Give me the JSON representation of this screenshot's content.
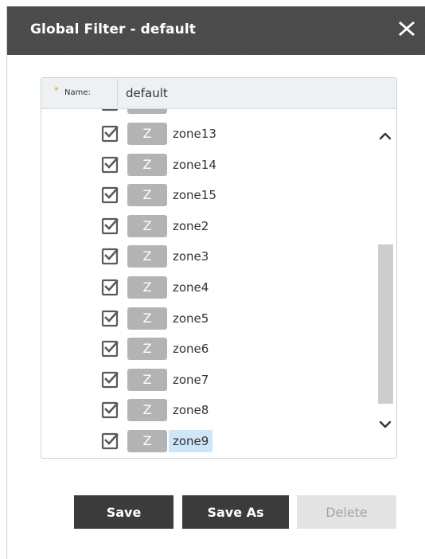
{
  "dialog": {
    "title": "Global Filter - default",
    "close_icon": "close-icon"
  },
  "form": {
    "required_marker": "*",
    "name_label": "Name:",
    "name_value": "default"
  },
  "zones": [
    {
      "badge": "Z",
      "name": "zone13",
      "checked": true,
      "selected": false
    },
    {
      "badge": "Z",
      "name": "zone14",
      "checked": true,
      "selected": false
    },
    {
      "badge": "Z",
      "name": "zone15",
      "checked": true,
      "selected": false
    },
    {
      "badge": "Z",
      "name": "zone2",
      "checked": true,
      "selected": false
    },
    {
      "badge": "Z",
      "name": "zone3",
      "checked": true,
      "selected": false
    },
    {
      "badge": "Z",
      "name": "zone4",
      "checked": true,
      "selected": false
    },
    {
      "badge": "Z",
      "name": "zone5",
      "checked": true,
      "selected": false
    },
    {
      "badge": "Z",
      "name": "zone6",
      "checked": true,
      "selected": false
    },
    {
      "badge": "Z",
      "name": "zone7",
      "checked": true,
      "selected": false
    },
    {
      "badge": "Z",
      "name": "zone8",
      "checked": true,
      "selected": false
    },
    {
      "badge": "Z",
      "name": "zone9",
      "checked": true,
      "selected": true
    }
  ],
  "buttons": {
    "save": "Save",
    "save_as": "Save As",
    "delete": "Delete",
    "delete_enabled": false
  },
  "colors": {
    "title_bar": "#4a4a4a",
    "badge": "#b3b3b3",
    "selection": "#cfe5f8",
    "required": "#e08a1e"
  }
}
